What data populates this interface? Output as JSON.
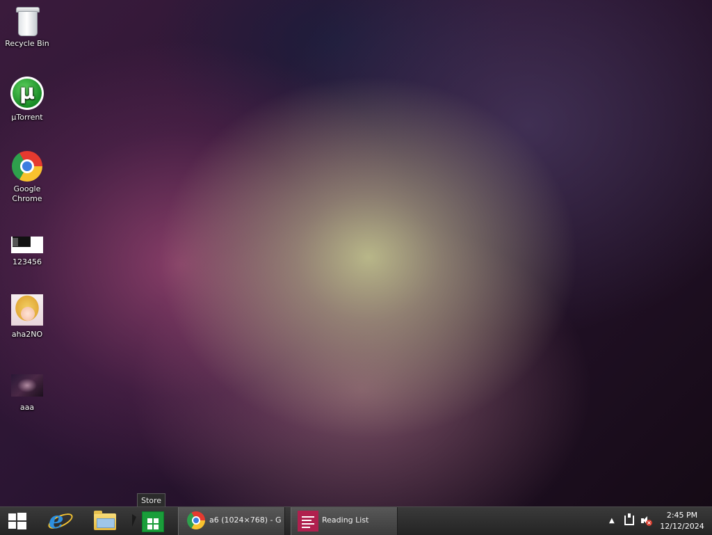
{
  "desktop": {
    "icons": [
      {
        "label": "Recycle Bin"
      },
      {
        "label": "µTorrent"
      },
      {
        "label": "Google Chrome"
      },
      {
        "label": "123456"
      },
      {
        "label": "aha2NO"
      },
      {
        "label": "aaa"
      }
    ]
  },
  "tooltip": {
    "text": "Store"
  },
  "taskbar": {
    "pinned": [
      {
        "name": "Start",
        "icon": "windows-logo-icon"
      },
      {
        "name": "Internet Explorer",
        "icon": "internet-explorer-icon"
      },
      {
        "name": "File Explorer",
        "icon": "folder-icon"
      },
      {
        "name": "Store",
        "icon": "store-icon"
      }
    ],
    "windows": [
      {
        "label": "a6 (1024×768) - G...",
        "icon": "chrome-icon"
      },
      {
        "label": "Reading List",
        "icon": "reading-list-icon"
      }
    ],
    "tray": {
      "show_hidden": "▲",
      "mute_mark": "×"
    },
    "clock": {
      "time": "2:45 PM",
      "date": "12/12/2024"
    }
  }
}
